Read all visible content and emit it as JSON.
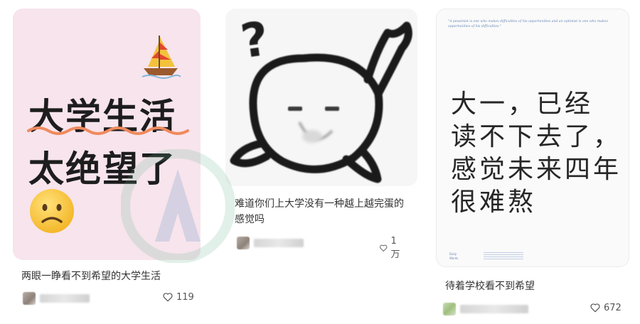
{
  "posts": [
    {
      "cover_lines": [
        "大学生活",
        "太绝望了"
      ],
      "title": "两眼一睁看不到希望的大学生活",
      "likes": "119",
      "cover_icons": [
        "sailboat-icon",
        "frowning-face-icon"
      ]
    },
    {
      "cover_symbol": "?",
      "title": "难道你们上大学没有一种越上越完蛋的感觉吗",
      "likes": "1万",
      "cover_icons": [
        "question-mark-icon",
        "whale-doodle-icon"
      ]
    },
    {
      "quote": "\"A pessimist is one who makes difficulties of his opportunities and an optimist is one who makes opportunities of his difficulties.\"",
      "hand_lines": [
        "大一，已经",
        "读不下去了，",
        "感觉未来四年",
        "很难熬"
      ],
      "footer_left": "Daily Words",
      "title": "待着学校看不到希望",
      "likes": "672"
    }
  ],
  "colors": {
    "card1_bg": "#f7e4ec",
    "squiggle": "#f08a5d",
    "heart_stroke": "#555555"
  }
}
